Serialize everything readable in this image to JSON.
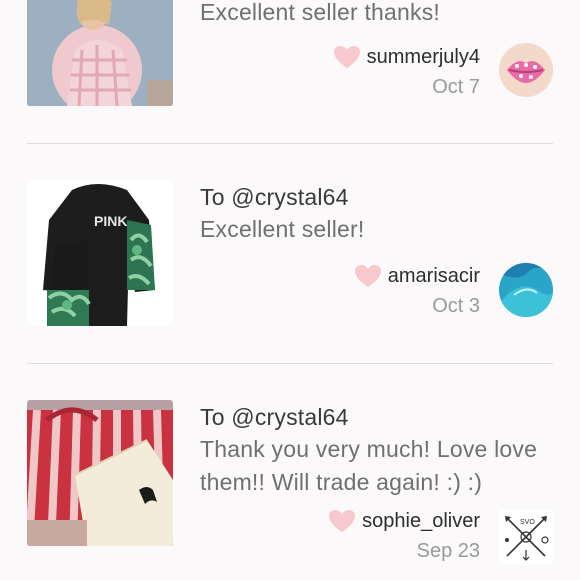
{
  "reviews": [
    {
      "to": "",
      "message": "Excellent seller thanks!",
      "username": "summerjuly4",
      "date": "Oct 7",
      "thumb_icon": "pink-pajamas-photo",
      "avatar_icon": "lips-avatar"
    },
    {
      "to": "To @crystal64",
      "message": "Excellent seller!",
      "username": "amarisacir",
      "date": "Oct 3",
      "thumb_icon": "pink-hoodie-photo",
      "thumb_text": "PINK",
      "avatar_icon": "ocean-avatar"
    },
    {
      "to": "To @crystal64",
      "message": "Thank you very much! Love love them!! Will trade again! :) :)",
      "username": "sophie_oliver",
      "date": "Sep 23",
      "thumb_icon": "striped-bag-photo",
      "avatar_icon": "crossed-arrows-avatar",
      "avatar_text": "SVO"
    }
  ],
  "colors": {
    "heart": "#f7c9cd",
    "divider": "#dcdcdc",
    "background": "#fbf9fa"
  }
}
